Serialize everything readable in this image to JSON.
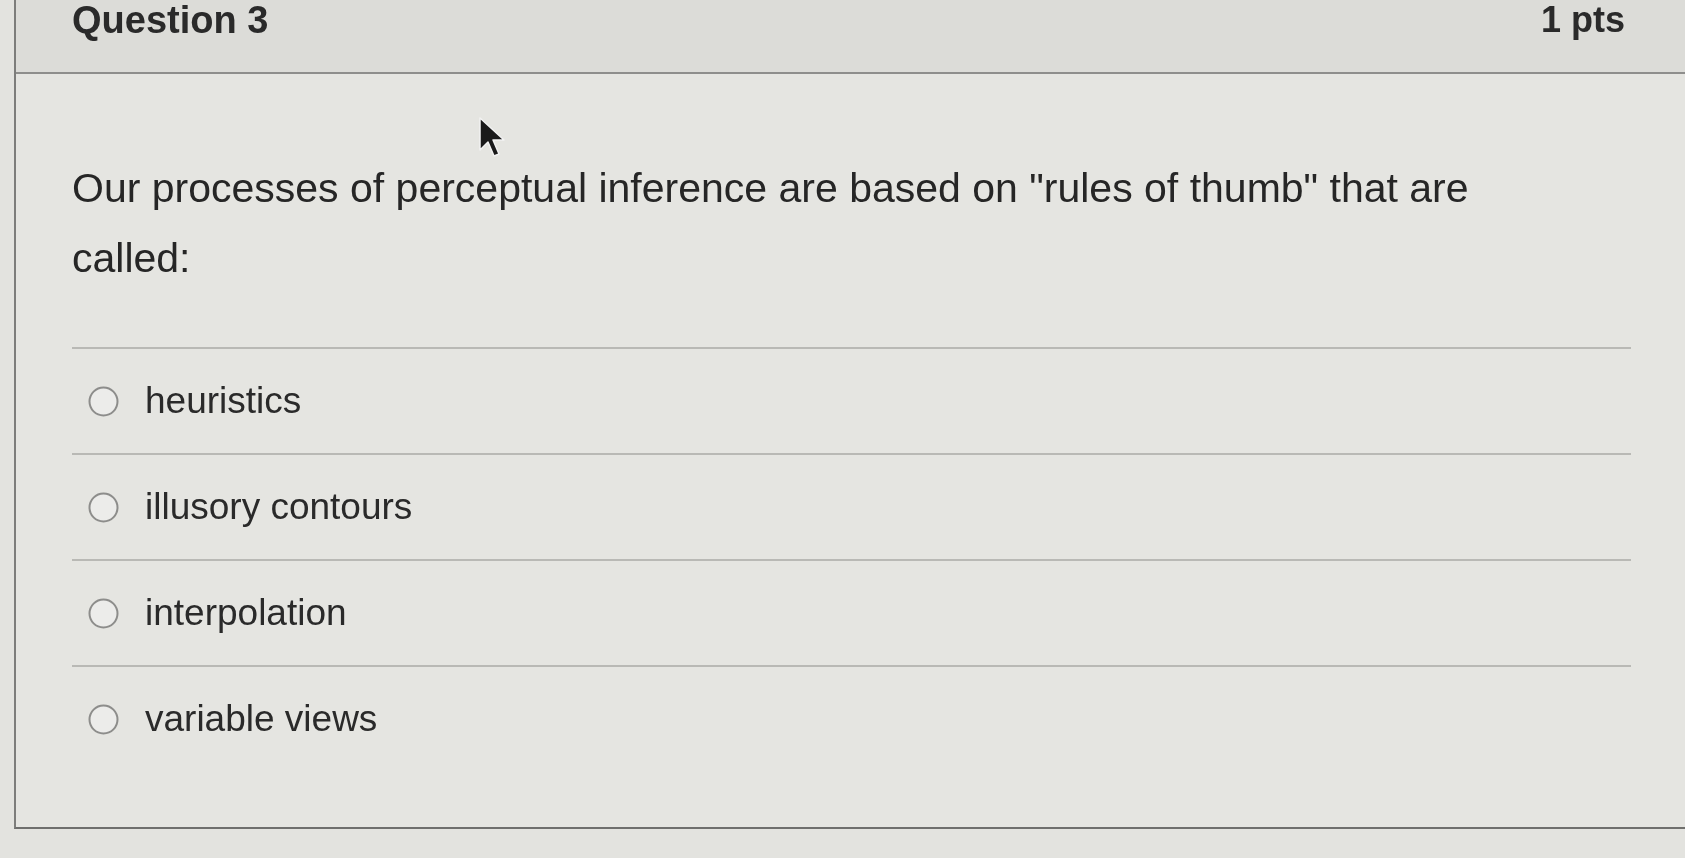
{
  "question": {
    "title": "Question 3",
    "points": "1 pts",
    "text": "Our processes of perceptual inference are based on \"rules of thumb\" that are called:"
  },
  "answers": [
    {
      "label": "heuristics",
      "selected": false
    },
    {
      "label": "illusory contours",
      "selected": false
    },
    {
      "label": "interpolation",
      "selected": false
    },
    {
      "label": "variable views",
      "selected": false
    }
  ]
}
